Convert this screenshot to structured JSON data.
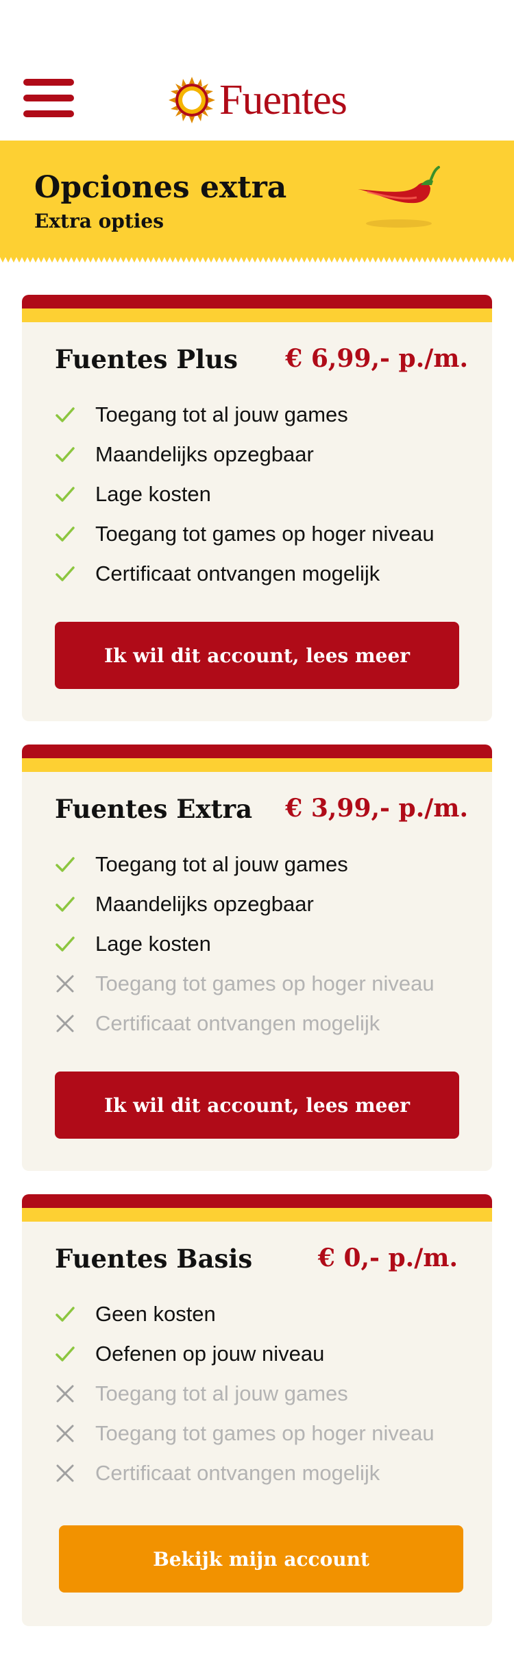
{
  "header": {
    "logo_text": "Fuentes"
  },
  "banner": {
    "title": "Opciones extra",
    "subtitle": "Extra opties"
  },
  "colors": {
    "brand_red": "#b00b18",
    "brand_yellow": "#fdd033",
    "check_green": "#8cc63f",
    "cta_orange": "#f29200"
  },
  "plans": [
    {
      "name": "Fuentes Plus",
      "price": "€ 6,99,- p./m.",
      "features": [
        {
          "label": "Toegang tot al jouw games",
          "included": true
        },
        {
          "label": "Maandelijks opzegbaar",
          "included": true
        },
        {
          "label": "Lage kosten",
          "included": true
        },
        {
          "label": "Toegang tot games op hoger niveau",
          "included": true
        },
        {
          "label": "Certificaat ontvangen mogelijk",
          "included": true
        }
      ],
      "cta": "Ik wil dit account, lees meer"
    },
    {
      "name": "Fuentes Extra",
      "price": "€ 3,99,- p./m.",
      "features": [
        {
          "label": "Toegang tot al jouw games",
          "included": true
        },
        {
          "label": "Maandelijks opzegbaar",
          "included": true
        },
        {
          "label": "Lage kosten",
          "included": true
        },
        {
          "label": "Toegang tot games op hoger niveau",
          "included": false
        },
        {
          "label": "Certificaat ontvangen mogelijk",
          "included": false
        }
      ],
      "cta": "Ik wil dit account, lees meer"
    },
    {
      "name": "Fuentes Basis",
      "price": "€ 0,- p./m.",
      "features": [
        {
          "label": "Geen kosten",
          "included": true
        },
        {
          "label": "Oefenen op jouw niveau",
          "included": true
        },
        {
          "label": "Toegang tot al jouw games",
          "included": false
        },
        {
          "label": "Toegang tot games op hoger niveau",
          "included": false
        },
        {
          "label": "Certificaat ontvangen mogelijk",
          "included": false
        }
      ],
      "cta": "Bekijk mijn account"
    }
  ]
}
